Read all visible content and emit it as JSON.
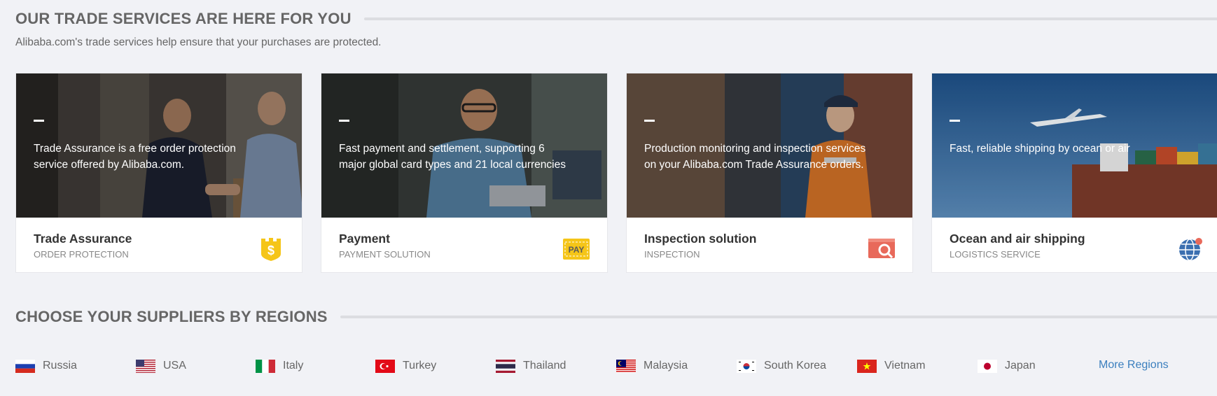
{
  "trade_services": {
    "title": "OUR TRADE SERVICES ARE HERE FOR YOU",
    "subtitle": "Alibaba.com's trade services help ensure that your purchases are protected.",
    "cards": [
      {
        "description": "Trade Assurance is a free order protection service offered by Alibaba.com.",
        "title": "Trade Assurance",
        "subtitle": "ORDER PROTECTION",
        "icon": "shield-dollar-icon",
        "icon_color": "#f5c518"
      },
      {
        "description": "Fast payment and settlement, supporting 6 major global card types and 21 local currencies",
        "title": "Payment",
        "subtitle": "PAYMENT SOLUTION",
        "icon": "pay-card-icon",
        "icon_label": "PAY",
        "icon_color": "#f5c518"
      },
      {
        "description": "Production monitoring and inspection services on your Alibaba.com Trade Assurance orders.",
        "title": "Inspection solution",
        "subtitle": "INSPECTION",
        "icon": "inspection-magnifier-icon",
        "icon_color": "#e8695a"
      },
      {
        "description": "Fast, reliable shipping by ocean or air",
        "title": "Ocean and air shipping",
        "subtitle": "LOGISTICS SERVICE",
        "icon": "globe-icon",
        "icon_color": "#3b6fb0"
      }
    ]
  },
  "regions": {
    "title": "CHOOSE YOUR SUPPLIERS BY REGIONS",
    "items": [
      {
        "label": "Russia",
        "flag": "russia-flag-icon"
      },
      {
        "label": "USA",
        "flag": "usa-flag-icon"
      },
      {
        "label": "Italy",
        "flag": "italy-flag-icon"
      },
      {
        "label": "Turkey",
        "flag": "turkey-flag-icon"
      },
      {
        "label": "Thailand",
        "flag": "thailand-flag-icon"
      },
      {
        "label": "Malaysia",
        "flag": "malaysia-flag-icon"
      },
      {
        "label": "South Korea",
        "flag": "south-korea-flag-icon"
      },
      {
        "label": "Vietnam",
        "flag": "vietnam-flag-icon"
      },
      {
        "label": "Japan",
        "flag": "japan-flag-icon"
      }
    ],
    "more_label": "More Regions"
  },
  "colors": {
    "background": "#f1f2f6",
    "link": "#3b7fbe",
    "heading": "#666666"
  }
}
